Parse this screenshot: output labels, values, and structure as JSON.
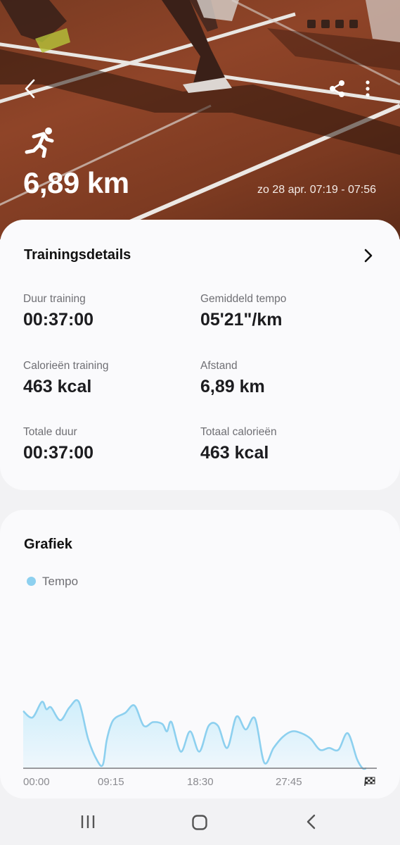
{
  "header": {
    "distance": "6,89 km",
    "datetime": "zo 28 apr. 07:19 - 07:56"
  },
  "icons": {
    "back": "chevron-left-icon",
    "share": "share-icon",
    "more": "more-vert-icon",
    "activity": "running-icon"
  },
  "details": {
    "title": "Trainingsdetails",
    "stats": [
      {
        "label": "Duur training",
        "value": "00:37:00"
      },
      {
        "label": "Gemiddeld tempo",
        "value": "05'21\"/km"
      },
      {
        "label": "Calorieën training",
        "value": "463 kcal"
      },
      {
        "label": "Afstand",
        "value": "6,89 km"
      },
      {
        "label": "Totale duur",
        "value": "00:37:00"
      },
      {
        "label": "Totaal calorieën",
        "value": "463 kcal"
      }
    ]
  },
  "graph": {
    "title": "Grafiek",
    "legend": "Tempo",
    "x_ticks": [
      "00:00",
      "09:15",
      "18:30",
      "27:45"
    ]
  },
  "colors": {
    "series": "#8dd0ef",
    "series_fill": "#cfeefb",
    "card_bg": "#fafafc",
    "page_bg": "#f2f2f4"
  },
  "chart_data": {
    "type": "area",
    "series": [
      {
        "name": "Tempo",
        "x": [
          0,
          1,
          2,
          2.5,
          3,
          4,
          5,
          6,
          7,
          8,
          8.6,
          9,
          9.5,
          10,
          11,
          12,
          13,
          14,
          15,
          15.5,
          16,
          17,
          18,
          19,
          20,
          21,
          22,
          23,
          24,
          25,
          26,
          27,
          28,
          29,
          30,
          31,
          32,
          33,
          34,
          35,
          36,
          36.6,
          37
        ],
        "values": [
          62,
          55,
          72,
          64,
          66,
          52,
          66,
          72,
          32,
          8,
          4,
          30,
          48,
          55,
          60,
          68,
          46,
          50,
          48,
          40,
          50,
          18,
          40,
          18,
          46,
          46,
          22,
          56,
          42,
          54,
          6,
          22,
          34,
          40,
          38,
          32,
          20,
          22,
          20,
          38,
          10,
          0,
          0
        ]
      }
    ],
    "x_range": [
      0,
      37
    ],
    "y_range": [
      0,
      100
    ],
    "x_tick_labels": [
      "00:00",
      "09:15",
      "18:30",
      "27:45"
    ],
    "legend_position": "top-left",
    "grid": false
  }
}
